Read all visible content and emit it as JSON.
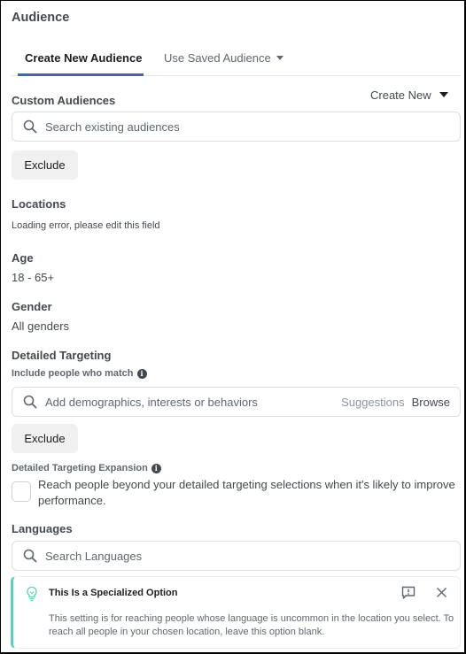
{
  "header": {
    "title": "Audience"
  },
  "tabs": [
    {
      "label": "Create New Audience",
      "active": true
    },
    {
      "label": "Use Saved Audience",
      "has_dropdown": true
    }
  ],
  "accent_color": "#4267B2",
  "custom_audiences": {
    "label": "Custom Audiences",
    "create_new_label": "Create New",
    "search_placeholder": "Search existing audiences",
    "exclude_label": "Exclude"
  },
  "locations": {
    "label": "Locations",
    "value": "Loading error, please edit this field"
  },
  "age": {
    "label": "Age",
    "value": "18 - 65+"
  },
  "gender": {
    "label": "Gender",
    "value": "All genders"
  },
  "detailed_targeting": {
    "label": "Detailed Targeting",
    "sub_label": "Include people who match",
    "info_icon": "info-icon",
    "search_placeholder": "Add demographics, interests or behaviors",
    "suggestions_label": "Suggestions",
    "browse_label": "Browse",
    "exclude_label": "Exclude"
  },
  "expansion": {
    "label": "Detailed Targeting Expansion",
    "checkbox_text": "Reach people beyond your detailed targeting selections when it's likely to improve performance.",
    "checked": false
  },
  "languages": {
    "label": "Languages",
    "search_placeholder": "Search Languages"
  },
  "notice": {
    "title": "This Is a Specialized Option",
    "body": "This setting is for reaching people whose language is uncommon in the location you select. To reach all people in your chosen location, leave this option blank.",
    "accent_color": "#5fcdb9",
    "icons": [
      "lightbulb-icon",
      "feedback-icon",
      "close-icon"
    ]
  }
}
